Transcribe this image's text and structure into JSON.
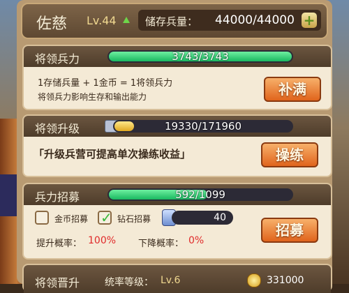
{
  "header": {
    "name": "佐慈",
    "level": "Lv.44",
    "storage_label": "储存兵量：",
    "storage_value": "44000/44000"
  },
  "command": {
    "title": "将领兵力",
    "bar_text": "3743/3743",
    "progress": 1.0,
    "line1": "1存储兵量 + 1金币 = 1将领兵力",
    "line2": "将领兵力影响生存和输出能力",
    "button": "补满"
  },
  "upgrade": {
    "title": "将领升级",
    "bar_text": "19330/171960",
    "progress": 0.112,
    "hint": "「升级兵营可提高单次操练收益」",
    "button": "操练"
  },
  "recruit": {
    "title": "兵力招募",
    "bar_text": "592/1099",
    "progress": 0.539,
    "gold_option": "金币招募",
    "gold_checked": false,
    "diamond_option": "钻石招募",
    "diamond_checked": true,
    "diamond_count": "40",
    "up_label": "提升概率：",
    "up_value": "100%",
    "down_label": "下降概率：",
    "down_value": "0%",
    "button": "招募"
  },
  "promote": {
    "title": "将领晋升",
    "rank_label": "统率等级：",
    "rank_value": "Lv.6",
    "cost": "331000"
  },
  "colors": {
    "accent_orange": "#e0641c",
    "bar_green": "#19b860",
    "bar_yellow": "#e0a820",
    "rate_red": "#e02a2a"
  }
}
